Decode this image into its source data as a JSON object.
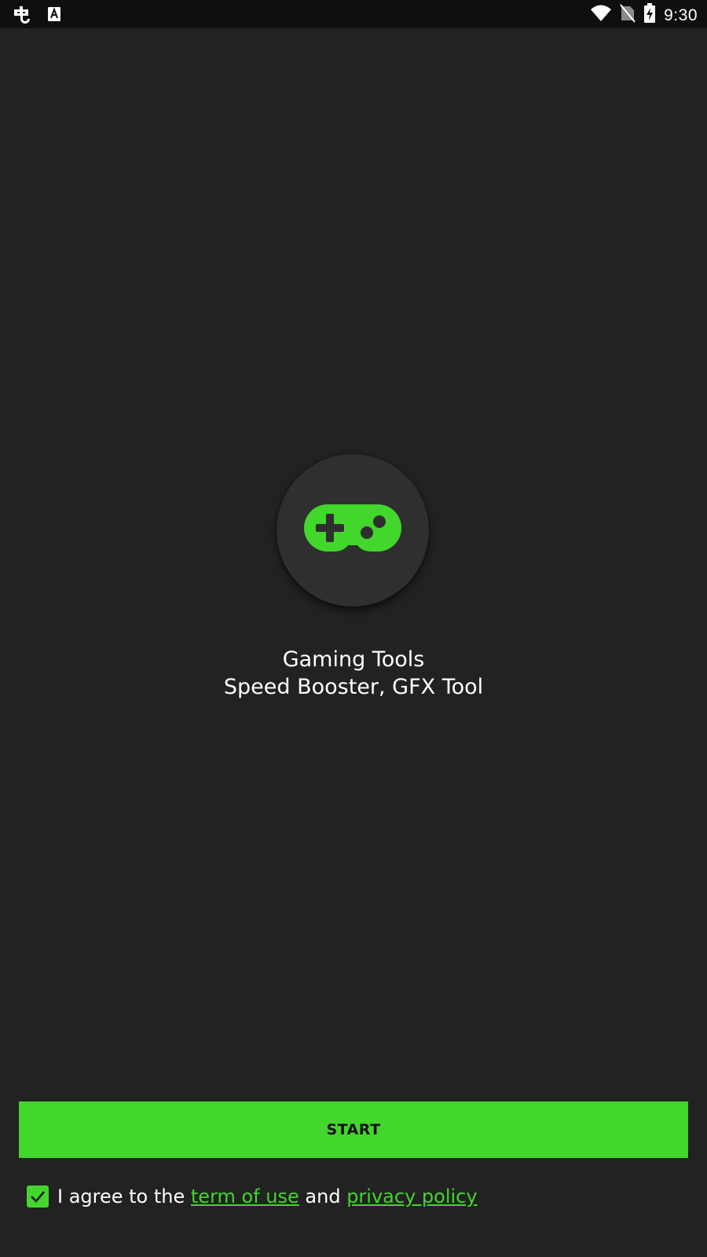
{
  "status_bar": {
    "time": "9:30",
    "icons": [
      "puzzle-bug-icon",
      "keyboard-a-icon",
      "wifi-icon",
      "no-sim-icon",
      "battery-charging-icon"
    ]
  },
  "app": {
    "logo_icon": "gamepad-icon",
    "title": "Gaming Tools",
    "subtitle": "Speed Booster, GFX Tool"
  },
  "start_button": {
    "label": "START"
  },
  "agreement": {
    "checked": true,
    "prefix": "I agree to the ",
    "terms_link": "term of use",
    "conjunction": " and ",
    "privacy_link": "privacy policy"
  },
  "colors": {
    "background": "#222222",
    "status_bar": "#0f0f0f",
    "accent": "#43d62d",
    "logo_circle": "#2f2f2f"
  }
}
